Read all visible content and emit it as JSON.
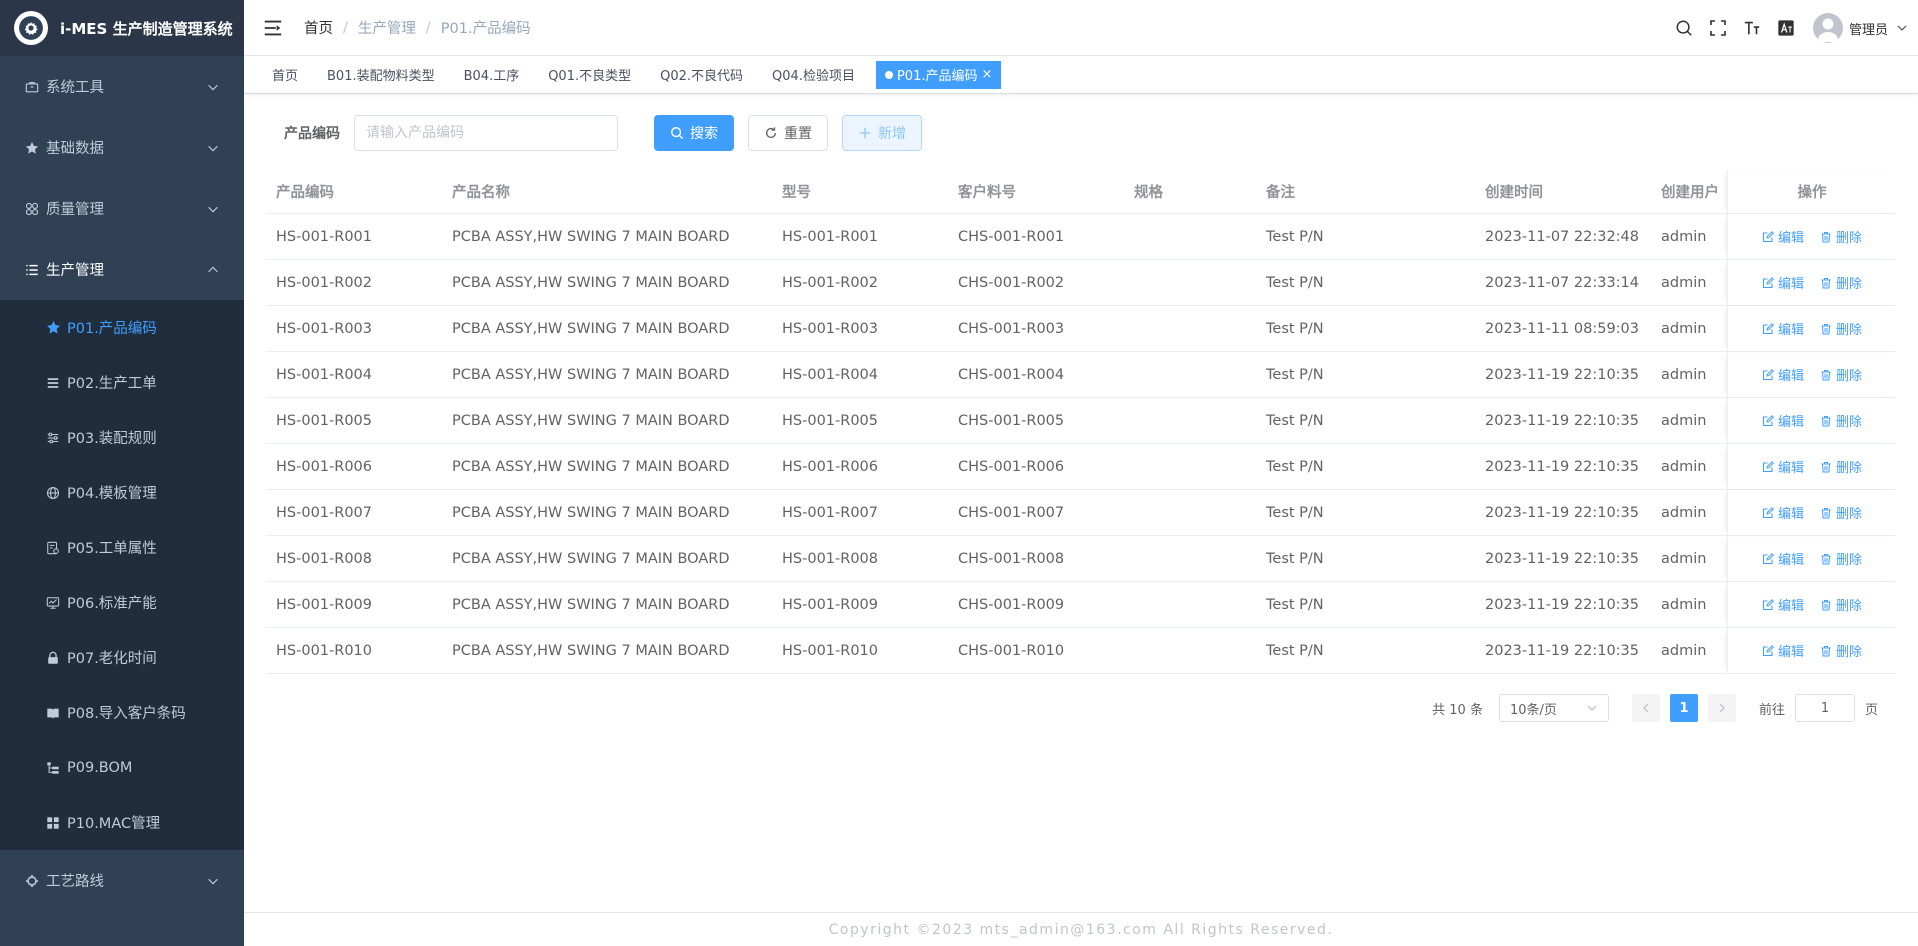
{
  "app": {
    "title": "i-MES 生产制造管理系统"
  },
  "sidebar": {
    "menus": [
      {
        "label": "系统工具",
        "icon": "toolbox-icon"
      },
      {
        "label": "基础数据",
        "icon": "star-icon"
      },
      {
        "label": "质量管理",
        "icon": "grid-icon"
      },
      {
        "label": "生产管理",
        "icon": "list-icon"
      }
    ],
    "sub_items": [
      {
        "label": "P01.产品编码",
        "icon": "star-icon",
        "active": true
      },
      {
        "label": "P02.生产工单",
        "icon": "menu-icon"
      },
      {
        "label": "P03.装配规则",
        "icon": "sliders-icon"
      },
      {
        "label": "P04.模板管理",
        "icon": "globe-icon"
      },
      {
        "label": "P05.工单属性",
        "icon": "form-icon"
      },
      {
        "label": "P06.标准产能",
        "icon": "monitor-icon"
      },
      {
        "label": "P07.老化时间",
        "icon": "lock-icon"
      },
      {
        "label": "P08.导入客户条码",
        "icon": "book-icon"
      },
      {
        "label": "P09.BOM",
        "icon": "tree-icon"
      },
      {
        "label": "P10.MAC管理",
        "icon": "dashboard-icon"
      }
    ],
    "bottom_menu": {
      "label": "工艺路线",
      "icon": "route-icon"
    }
  },
  "breadcrumb": {
    "home": "首页",
    "parent": "生产管理",
    "current": "P01.产品编码",
    "sep": "/"
  },
  "user": {
    "name": "管理员"
  },
  "tags": [
    {
      "label": "首页"
    },
    {
      "label": "B01.装配物料类型"
    },
    {
      "label": "B04.工序"
    },
    {
      "label": "Q01.不良类型"
    },
    {
      "label": "Q02.不良代码"
    },
    {
      "label": "Q04.检验项目"
    },
    {
      "label": "P01.产品编码",
      "active": true,
      "close": "×"
    }
  ],
  "search": {
    "label": "产品编码",
    "placeholder": "请输入产品编码",
    "search_btn": "搜索",
    "reset_btn": "重置",
    "add_btn": "新增"
  },
  "table": {
    "headers": [
      "产品编码",
      "产品名称",
      "型号",
      "客户料号",
      "规格",
      "备注",
      "创建时间",
      "创建用户",
      "操作"
    ],
    "edit_label": "编辑",
    "delete_label": "删除",
    "rows": [
      [
        "HS-001-R001",
        "PCBA ASSY,HW SWING 7 MAIN BOARD",
        "HS-001-R001",
        "CHS-001-R001",
        "",
        "Test P/N",
        "2023-11-07 22:32:48",
        "admin"
      ],
      [
        "HS-001-R002",
        "PCBA ASSY,HW SWING 7 MAIN BOARD",
        "HS-001-R002",
        "CHS-001-R002",
        "",
        "Test P/N",
        "2023-11-07 22:33:14",
        "admin"
      ],
      [
        "HS-001-R003",
        "PCBA ASSY,HW SWING 7 MAIN BOARD",
        "HS-001-R003",
        "CHS-001-R003",
        "",
        "Test P/N",
        "2023-11-11 08:59:03",
        "admin"
      ],
      [
        "HS-001-R004",
        "PCBA ASSY,HW SWING 7 MAIN BOARD",
        "HS-001-R004",
        "CHS-001-R004",
        "",
        "Test P/N",
        "2023-11-19 22:10:35",
        "admin"
      ],
      [
        "HS-001-R005",
        "PCBA ASSY,HW SWING 7 MAIN BOARD",
        "HS-001-R005",
        "CHS-001-R005",
        "",
        "Test P/N",
        "2023-11-19 22:10:35",
        "admin"
      ],
      [
        "HS-001-R006",
        "PCBA ASSY,HW SWING 7 MAIN BOARD",
        "HS-001-R006",
        "CHS-001-R006",
        "",
        "Test P/N",
        "2023-11-19 22:10:35",
        "admin"
      ],
      [
        "HS-001-R007",
        "PCBA ASSY,HW SWING 7 MAIN BOARD",
        "HS-001-R007",
        "CHS-001-R007",
        "",
        "Test P/N",
        "2023-11-19 22:10:35",
        "admin"
      ],
      [
        "HS-001-R008",
        "PCBA ASSY,HW SWING 7 MAIN BOARD",
        "HS-001-R008",
        "CHS-001-R008",
        "",
        "Test P/N",
        "2023-11-19 22:10:35",
        "admin"
      ],
      [
        "HS-001-R009",
        "PCBA ASSY,HW SWING 7 MAIN BOARD",
        "HS-001-R009",
        "CHS-001-R009",
        "",
        "Test P/N",
        "2023-11-19 22:10:35",
        "admin"
      ],
      [
        "HS-001-R010",
        "PCBA ASSY,HW SWING 7 MAIN BOARD",
        "HS-001-R010",
        "CHS-001-R010",
        "",
        "Test P/N",
        "2023-11-19 22:10:35",
        "admin"
      ]
    ]
  },
  "pagination": {
    "total_text": "共 10 条",
    "page_size": "10条/页",
    "current_page": "1",
    "jump_label": "前往",
    "jump_value": "1",
    "page_unit": "页"
  },
  "footer": {
    "text": "Copyright ©2023 mts_admin@163.com All Rights Reserved."
  },
  "colors": {
    "sidebar_bg": "#304156",
    "accent": "#409eff",
    "submenu_bg": "#1f2d3d"
  }
}
